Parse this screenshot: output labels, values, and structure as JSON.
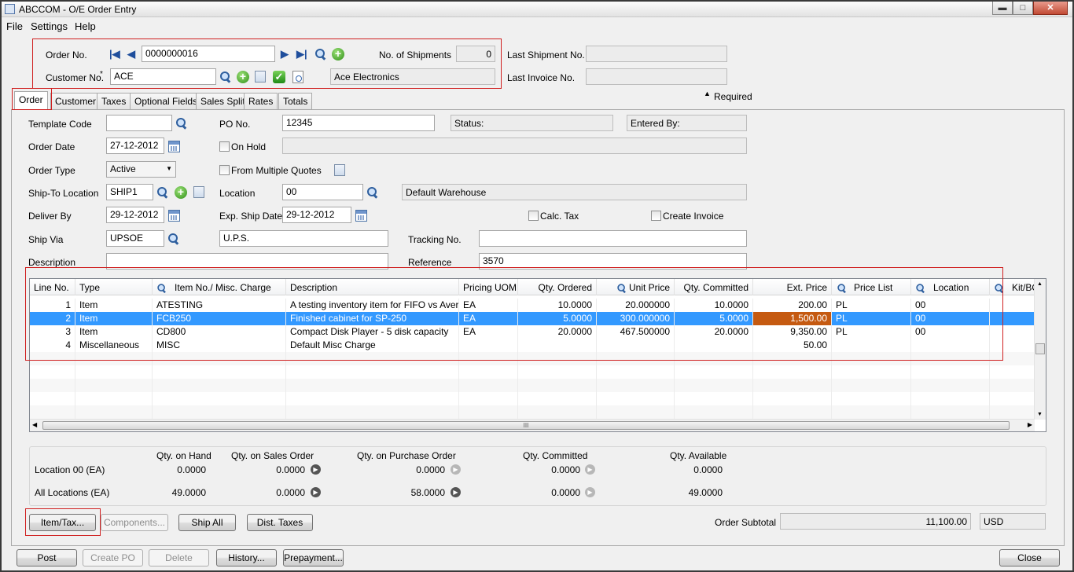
{
  "window": {
    "title": "ABCCOM - O/E Order Entry"
  },
  "menu": {
    "file": "File",
    "settings": "Settings",
    "help": "Help"
  },
  "header": {
    "order_no_label": "Order No.",
    "order_no": "0000000016",
    "shipments_label": "No. of Shipments",
    "shipments": "0",
    "last_shipment_label": "Last Shipment No.",
    "last_shipment": "",
    "customer_label": "Customer No.",
    "required_marker": "*",
    "customer_no": "ACE",
    "customer_name": "Ace Electronics",
    "last_invoice_label": "Last Invoice No.",
    "last_invoice": "",
    "required_note": "Required"
  },
  "tabs": [
    "Order",
    "Customer",
    "Taxes",
    "Optional Fields",
    "Sales Split",
    "Rates",
    "Totals"
  ],
  "order": {
    "template_label": "Template Code",
    "template": "",
    "po_label": "PO No.",
    "po": "12345",
    "status_label": "Status:",
    "entered_by_label": "Entered By:",
    "order_date_label": "Order Date",
    "order_date": "27-12-2012",
    "on_hold_label": "On Hold",
    "order_type_label": "Order Type",
    "order_type": "Active",
    "multi_quotes_label": "From Multiple Quotes",
    "shipto_label": "Ship-To Location",
    "shipto": "SHIP1",
    "location_label": "Location",
    "location": "00",
    "location_name": "Default Warehouse",
    "deliver_label": "Deliver By",
    "deliver": "29-12-2012",
    "expship_label": "Exp. Ship Date",
    "expship": "29-12-2012",
    "calc_tax_label": "Calc. Tax",
    "create_invoice_label": "Create Invoice",
    "shipvia_label": "Ship Via",
    "shipvia": "UPSOE",
    "shipvia_name": "U.P.S.",
    "tracking_label": "Tracking No.",
    "tracking": "",
    "description_label": "Description",
    "description": "",
    "reference_label": "Reference",
    "reference": "3570"
  },
  "grid": {
    "headers": [
      "Line No.",
      "Type",
      "Item No./ Misc. Charge",
      "Description",
      "Pricing UOM",
      "Qty. Ordered",
      "Unit Price",
      "Qty. Committed",
      "Ext. Price",
      "Price List",
      "Location",
      "Kit/BO"
    ],
    "rows": [
      [
        "1",
        "Item",
        "ATESTING",
        "A testing inventory item for FIFO vs Average",
        "EA",
        "10.0000",
        "20.000000",
        "10.0000",
        "200.00",
        "PL",
        "00"
      ],
      [
        "2",
        "Item",
        "FCB250",
        "Finished cabinet for SP-250",
        "EA",
        "5.0000",
        "300.000000",
        "5.0000",
        "1,500.00",
        "PL",
        "00"
      ],
      [
        "3",
        "Item",
        "CD800",
        "Compact Disk Player - 5 disk capacity",
        "EA",
        "20.0000",
        "467.500000",
        "20.0000",
        "9,350.00",
        "PL",
        "00"
      ],
      [
        "4",
        "Miscellaneous",
        "MISC",
        "Default Misc Charge",
        "",
        "",
        "",
        "",
        "50.00",
        "",
        ""
      ]
    ],
    "scroll_grip": "III"
  },
  "qty": {
    "headers": [
      "Qty. on Hand",
      "Qty. on Sales Order",
      "Qty. on Purchase Order",
      "Qty. Committed",
      "Qty. Available"
    ],
    "rows": [
      {
        "label": "Location  00 (EA)",
        "values": [
          "0.0000",
          "0.0000",
          "0.0000",
          "0.0000",
          "0.0000"
        ]
      },
      {
        "label": "All Locations (EA)",
        "values": [
          "49.0000",
          "0.0000",
          "58.0000",
          "0.0000",
          "49.0000"
        ]
      }
    ]
  },
  "buttons": {
    "item_tax": "Item/Tax...",
    "components": "Components...",
    "ship_all": "Ship All",
    "dist_taxes": "Dist. Taxes",
    "post": "Post",
    "create_po": "Create PO",
    "delete": "Delete",
    "history": "History...",
    "prepayment": "Prepayment...",
    "close": "Close"
  },
  "totals": {
    "subtotal_label": "Order Subtotal",
    "subtotal": "11,100.00",
    "currency": "USD"
  },
  "colors": {
    "selected_row": "#3399ff",
    "ext_price_highlight": "#c55a11",
    "annotation_red": "#d02020"
  }
}
